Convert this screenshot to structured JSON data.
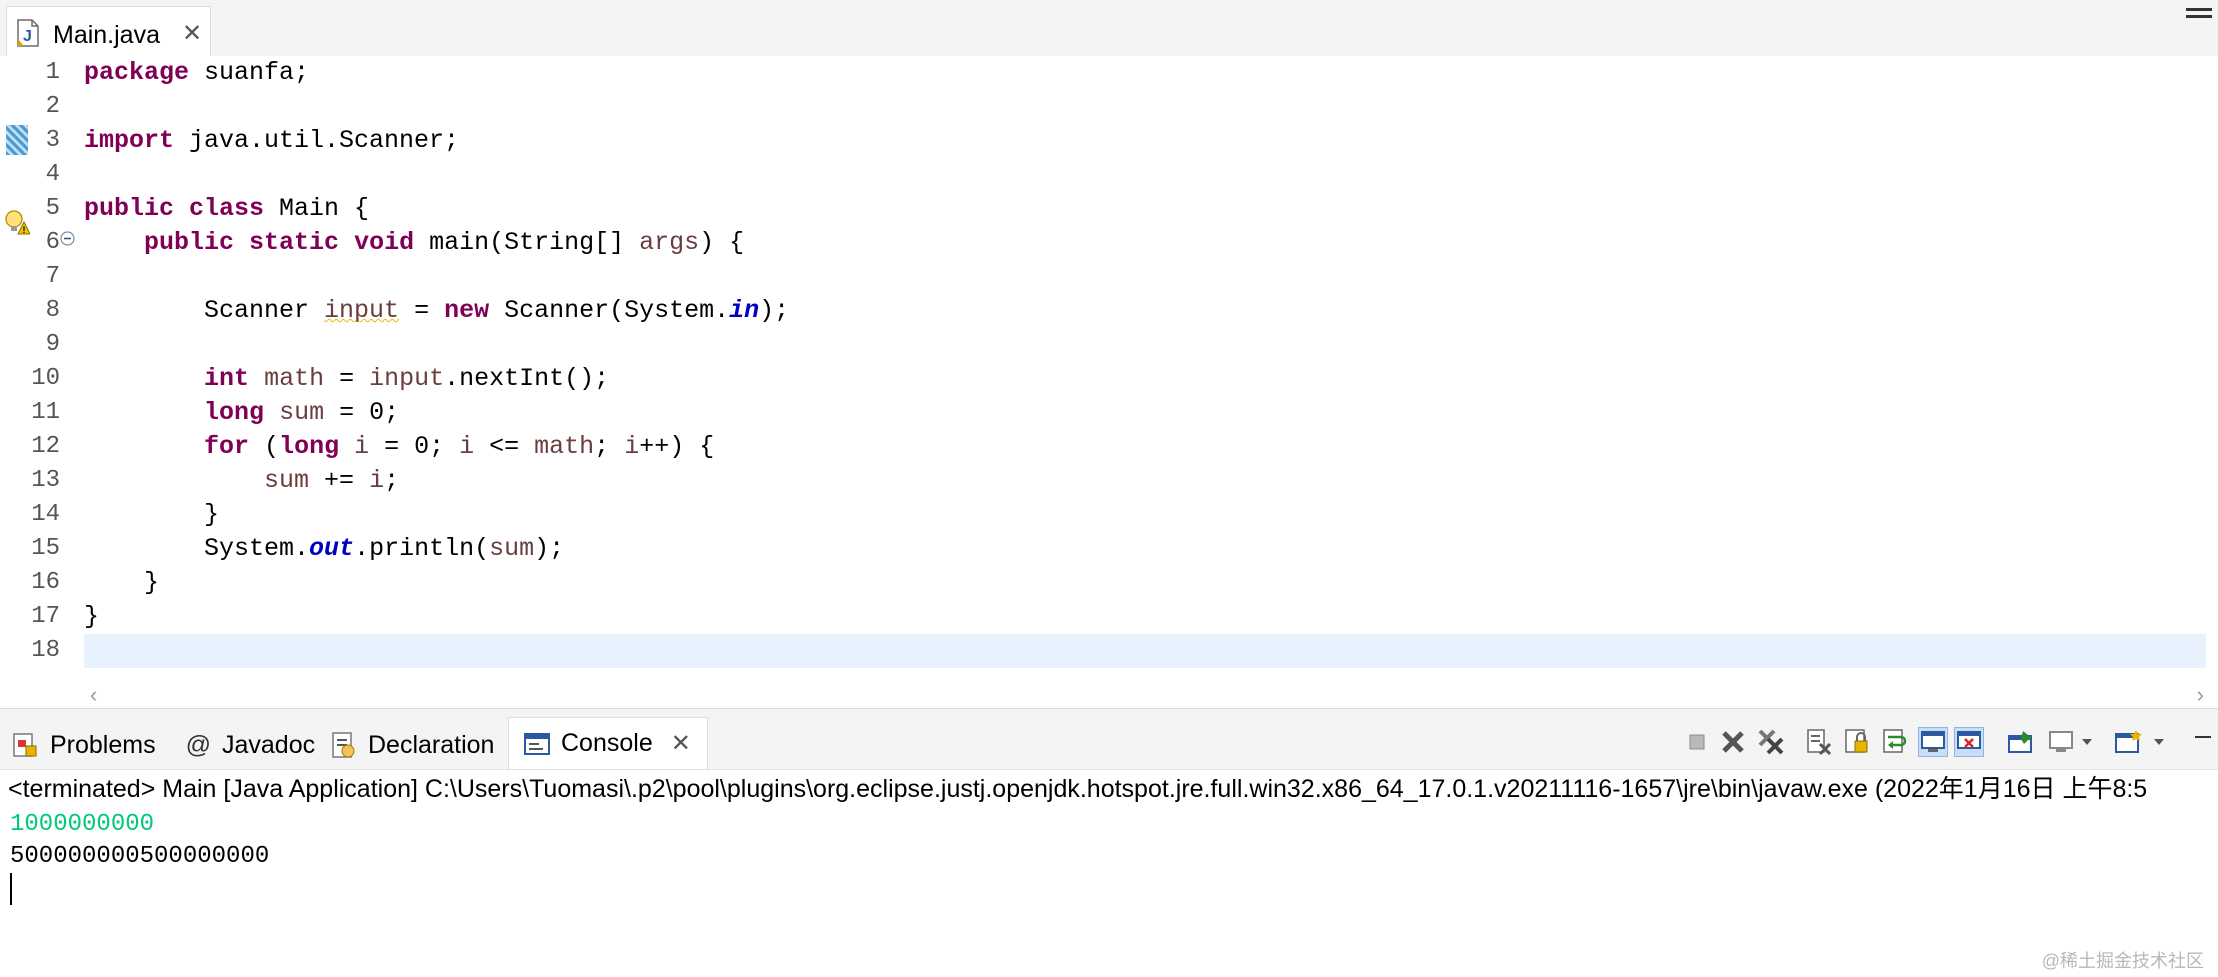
{
  "editor_tab": {
    "label": "Main.java",
    "close": "✕"
  },
  "code_lines": [
    {
      "n": "1",
      "tokens": [
        [
          "kw",
          "package"
        ],
        [
          "plain",
          " suanfa;"
        ]
      ]
    },
    {
      "n": "2",
      "tokens": []
    },
    {
      "n": "3",
      "tokens": [
        [
          "kw",
          "import"
        ],
        [
          "plain",
          " java.util.Scanner;"
        ]
      ]
    },
    {
      "n": "4",
      "tokens": []
    },
    {
      "n": "5",
      "tokens": [
        [
          "kw",
          "public"
        ],
        [
          "plain",
          " "
        ],
        [
          "kw",
          "class"
        ],
        [
          "plain",
          " Main {"
        ]
      ]
    },
    {
      "n": "6",
      "tokens": [
        [
          "plain",
          "    "
        ],
        [
          "kw",
          "public"
        ],
        [
          "plain",
          " "
        ],
        [
          "kw",
          "static"
        ],
        [
          "plain",
          " "
        ],
        [
          "kw",
          "void"
        ],
        [
          "plain",
          " main(String[] "
        ],
        [
          "var",
          "args"
        ],
        [
          "plain",
          ") {"
        ]
      ]
    },
    {
      "n": "7",
      "tokens": []
    },
    {
      "n": "8",
      "tokens": [
        [
          "plain",
          "        Scanner "
        ],
        [
          "warnvar",
          "input"
        ],
        [
          "plain",
          " = "
        ],
        [
          "kw",
          "new"
        ],
        [
          "plain",
          " Scanner(System."
        ],
        [
          "field",
          "in"
        ],
        [
          "plain",
          ");"
        ]
      ]
    },
    {
      "n": "9",
      "tokens": []
    },
    {
      "n": "10",
      "tokens": [
        [
          "plain",
          "        "
        ],
        [
          "kw",
          "int"
        ],
        [
          "plain",
          " "
        ],
        [
          "var",
          "math"
        ],
        [
          "plain",
          " = "
        ],
        [
          "var",
          "input"
        ],
        [
          "plain",
          ".nextInt();"
        ]
      ]
    },
    {
      "n": "11",
      "tokens": [
        [
          "plain",
          "        "
        ],
        [
          "kw",
          "long"
        ],
        [
          "plain",
          " "
        ],
        [
          "var",
          "sum"
        ],
        [
          "plain",
          " = 0;"
        ]
      ]
    },
    {
      "n": "12",
      "tokens": [
        [
          "plain",
          "        "
        ],
        [
          "kw",
          "for"
        ],
        [
          "plain",
          " ("
        ],
        [
          "kw",
          "long"
        ],
        [
          "plain",
          " "
        ],
        [
          "var",
          "i"
        ],
        [
          "plain",
          " = 0; "
        ],
        [
          "var",
          "i"
        ],
        [
          "plain",
          " <= "
        ],
        [
          "var",
          "math"
        ],
        [
          "plain",
          "; "
        ],
        [
          "var",
          "i"
        ],
        [
          "plain",
          "++) {"
        ]
      ]
    },
    {
      "n": "13",
      "tokens": [
        [
          "plain",
          "            "
        ],
        [
          "var",
          "sum"
        ],
        [
          "plain",
          " += "
        ],
        [
          "var",
          "i"
        ],
        [
          "plain",
          ";"
        ]
      ]
    },
    {
      "n": "14",
      "tokens": [
        [
          "plain",
          "        }"
        ]
      ]
    },
    {
      "n": "15",
      "tokens": [
        [
          "plain",
          "        System."
        ],
        [
          "field",
          "out"
        ],
        [
          "plain",
          ".println("
        ],
        [
          "var",
          "sum"
        ],
        [
          "plain",
          ");"
        ]
      ]
    },
    {
      "n": "16",
      "tokens": [
        [
          "plain",
          "    }"
        ]
      ]
    },
    {
      "n": "17",
      "tokens": [
        [
          "plain",
          "}"
        ]
      ]
    },
    {
      "n": "18",
      "tokens": []
    }
  ],
  "view_tabs": {
    "problems": "Problems",
    "javadoc": "Javadoc",
    "declaration": "Declaration",
    "console": "Console",
    "javadoc_icon": "@",
    "close": "✕"
  },
  "console": {
    "header": "<terminated> Main [Java Application] C:\\Users\\Tuomasi\\.p2\\pool\\plugins\\org.eclipse.justj.openjdk.hotspot.jre.full.win32.x86_64_17.0.1.v20211116-1657\\jre\\bin\\javaw.exe  (2022年1月16日 上午8:5",
    "input_line": "1000000000",
    "output_line": "500000000500000000"
  },
  "watermark": "@稀土掘金技术社区",
  "colors": {
    "keyword": "#7f0055",
    "variable": "#6a3e3e",
    "static_field": "#0000c0",
    "console_input": "#00c87d",
    "current_line": "#e8f2fe"
  },
  "icons": [
    "java-file-icon",
    "fold-minus-icon",
    "warning-bulb-icon",
    "problems-icon",
    "javadoc-icon",
    "declaration-icon",
    "console-icon",
    "terminate-icon",
    "remove-launch-icon",
    "remove-all-icon",
    "clear-console-icon",
    "scroll-lock-icon",
    "word-wrap-icon",
    "show-stdout-icon",
    "show-stderr-icon",
    "pin-console-icon",
    "display-console-icon",
    "open-console-icon",
    "view-menu-icon",
    "minimize-icon",
    "maximize-icon"
  ]
}
